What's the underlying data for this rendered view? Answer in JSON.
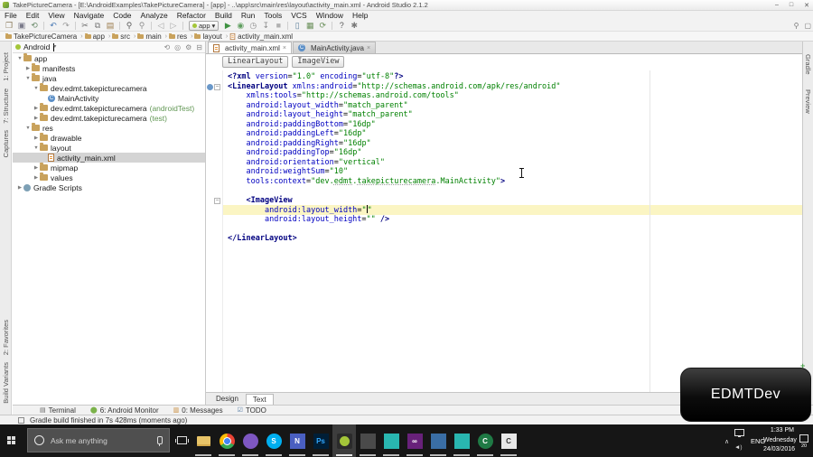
{
  "colors": {
    "accent_green": "#a4c639",
    "tag": "#000080",
    "attribute": "#0000c0",
    "value": "#008000",
    "selection": "#d4d4d4",
    "caret_line": "#fbf5c3",
    "suffix": "#629755",
    "taskbar_bg": "#161616"
  },
  "window": {
    "title": "TakePictureCamera - [E:\\AndroidExamples\\TakePictureCamera] - [app] - ..\\app\\src\\main\\res\\layout\\activity_main.xml - Android Studio 2.1.2",
    "minimize": "–",
    "maximize": "□",
    "close": "✕"
  },
  "menu": {
    "items": [
      "File",
      "Edit",
      "View",
      "Navigate",
      "Code",
      "Analyze",
      "Refactor",
      "Build",
      "Run",
      "Tools",
      "VCS",
      "Window",
      "Help"
    ]
  },
  "toolbar": {
    "run_config": "app",
    "run_caret": "▾",
    "icons": [
      {
        "name": "open-icon",
        "glyph": "❐",
        "color": "#8a7a5a"
      },
      {
        "name": "save-icon",
        "glyph": "▣",
        "color": "#7a7a8a"
      },
      {
        "name": "sync-files-icon",
        "glyph": "⟲",
        "color": "#6a8a6a"
      },
      {
        "name": "sep"
      },
      {
        "name": "undo-icon",
        "glyph": "↶",
        "color": "#4a7ab5"
      },
      {
        "name": "redo-icon",
        "glyph": "↷",
        "color": "#9a9a9a"
      },
      {
        "name": "sep"
      },
      {
        "name": "cut-icon",
        "glyph": "✂",
        "color": "#6a6a6a"
      },
      {
        "name": "copy-icon",
        "glyph": "⧉",
        "color": "#7a7a7a"
      },
      {
        "name": "paste-icon",
        "glyph": "▤",
        "color": "#9a7a4a"
      },
      {
        "name": "sep"
      },
      {
        "name": "find-icon",
        "glyph": "⚲",
        "color": "#5a5a5a"
      },
      {
        "name": "replace-icon",
        "glyph": "⚲",
        "color": "#8f8f8f"
      },
      {
        "name": "sep"
      },
      {
        "name": "back-icon",
        "glyph": "◁",
        "color": "#a5a5a5"
      },
      {
        "name": "forward-icon",
        "glyph": "▷",
        "color": "#a5a5a5"
      },
      {
        "name": "sep"
      },
      {
        "name": "run-config-select",
        "type": "chip"
      },
      {
        "name": "run-icon",
        "glyph": "▶",
        "color": "#3e9141"
      },
      {
        "name": "debug-icon",
        "glyph": "◉",
        "color": "#5f9e5f"
      },
      {
        "name": "coverage-icon",
        "glyph": "◷",
        "color": "#8a8a8a"
      },
      {
        "name": "attach-debugger-icon",
        "glyph": "↧",
        "color": "#8a8a8a"
      },
      {
        "name": "stop-icon",
        "glyph": "■",
        "color": "#b0b0b0"
      },
      {
        "name": "sep"
      },
      {
        "name": "avd-manager-icon",
        "glyph": "▯",
        "color": "#5a7f9a"
      },
      {
        "name": "sdk-manager-icon",
        "glyph": "▦",
        "color": "#6a8f5a"
      },
      {
        "name": "gradle-sync-icon",
        "glyph": "⟳",
        "color": "#6a8f5a"
      },
      {
        "name": "sep"
      },
      {
        "name": "help-icon",
        "glyph": "?",
        "color": "#5a5a5a"
      },
      {
        "name": "settings-icon",
        "glyph": "✱",
        "color": "#7a7a7a"
      }
    ],
    "right_icons": [
      {
        "name": "search-everywhere-icon",
        "glyph": "⚲"
      },
      {
        "name": "show-toolbar-icon",
        "glyph": "▢"
      }
    ]
  },
  "breadcrumbs": {
    "items": [
      "TakePictureCamera",
      "app",
      "src",
      "main",
      "res",
      "layout",
      "activity_main.xml"
    ],
    "separator": "›"
  },
  "left_stripe": {
    "top": [
      "1: Project",
      "7: Structure",
      "Captures"
    ],
    "bottom": [
      "2: Favorites",
      "Build Variants"
    ]
  },
  "right_stripe": {
    "items": [
      "Gradle",
      "Preview"
    ]
  },
  "project": {
    "selector": "Android",
    "selector_caret": "▾",
    "header_icons": [
      {
        "name": "collapse-all-icon",
        "glyph": "⟲"
      },
      {
        "name": "scroll-to-source-icon",
        "glyph": "◎"
      },
      {
        "name": "gear-icon",
        "glyph": "⚙"
      },
      {
        "name": "hide-panel-icon",
        "glyph": "⊟"
      }
    ],
    "tree": [
      {
        "label": "app",
        "depth": 0,
        "arrow": "down",
        "icon": "folder"
      },
      {
        "label": "manifests",
        "depth": 1,
        "arrow": "right",
        "icon": "folder"
      },
      {
        "label": "java",
        "depth": 1,
        "arrow": "down",
        "icon": "folder"
      },
      {
        "label": "dev.edmt.takepicturecamera",
        "depth": 2,
        "arrow": "down",
        "icon": "folder"
      },
      {
        "label": "MainActivity",
        "depth": 3,
        "arrow": "none",
        "icon": "class"
      },
      {
        "label": "dev.edmt.takepicturecamera",
        "suffix": "(androidTest)",
        "depth": 2,
        "arrow": "right",
        "icon": "folder"
      },
      {
        "label": "dev.edmt.takepicturecamera",
        "suffix": "(test)",
        "depth": 2,
        "arrow": "right",
        "icon": "folder"
      },
      {
        "label": "res",
        "depth": 1,
        "arrow": "down",
        "icon": "folder"
      },
      {
        "label": "drawable",
        "depth": 2,
        "arrow": "right",
        "icon": "folder"
      },
      {
        "label": "layout",
        "depth": 2,
        "arrow": "down",
        "icon": "folder"
      },
      {
        "label": "activity_main.xml",
        "depth": 3,
        "arrow": "none",
        "icon": "xml",
        "selected": true
      },
      {
        "label": "mipmap",
        "depth": 2,
        "arrow": "right",
        "icon": "folder"
      },
      {
        "label": "values",
        "depth": 2,
        "arrow": "right",
        "icon": "folder"
      },
      {
        "label": "Gradle Scripts",
        "depth": 0,
        "arrow": "right",
        "icon": "gradle"
      }
    ]
  },
  "editor": {
    "tabs": [
      {
        "label": "activity_main.xml",
        "icon": "xml",
        "close": "×",
        "active": true
      },
      {
        "label": "MainActivity.java",
        "icon": "class",
        "close": "×",
        "active": false
      }
    ],
    "chips": [
      "LinearLayout",
      "ImageView"
    ],
    "bottom_tabs": [
      {
        "label": "Design",
        "active": false
      },
      {
        "label": "Text",
        "active": true
      }
    ],
    "code": [
      {
        "seg": [
          [
            "<?xml ",
            "g"
          ],
          [
            "version",
            "a"
          ],
          [
            "=",
            "p"
          ],
          [
            "\"1.0\"",
            "v"
          ],
          [
            " ",
            "p"
          ],
          [
            "encoding",
            "a"
          ],
          [
            "=",
            "p"
          ],
          [
            "\"utf-8\"",
            "v"
          ],
          [
            "?>",
            "g"
          ]
        ]
      },
      {
        "seg": [
          [
            "<LinearLayout ",
            "g"
          ],
          [
            "xmlns:android",
            "a"
          ],
          [
            "=",
            "p"
          ],
          [
            "\"http://schemas.android.com/apk/res/android\"",
            "v"
          ]
        ],
        "fold": true,
        "gicon": true
      },
      {
        "seg": [
          [
            "    ",
            "p"
          ],
          [
            "xmlns:tools",
            "a"
          ],
          [
            "=",
            "p"
          ],
          [
            "\"http://schemas.android.com/tools\"",
            "v"
          ]
        ]
      },
      {
        "seg": [
          [
            "    ",
            "p"
          ],
          [
            "android:layout_width",
            "a"
          ],
          [
            "=",
            "p"
          ],
          [
            "\"match_parent\"",
            "v"
          ]
        ]
      },
      {
        "seg": [
          [
            "    ",
            "p"
          ],
          [
            "android:layout_height",
            "a"
          ],
          [
            "=",
            "p"
          ],
          [
            "\"match_parent\"",
            "v"
          ]
        ]
      },
      {
        "seg": [
          [
            "    ",
            "p"
          ],
          [
            "android:paddingBottom",
            "a"
          ],
          [
            "=",
            "p"
          ],
          [
            "\"16dp\"",
            "v"
          ]
        ]
      },
      {
        "seg": [
          [
            "    ",
            "p"
          ],
          [
            "android:paddingLeft",
            "a"
          ],
          [
            "=",
            "p"
          ],
          [
            "\"16dp\"",
            "v"
          ]
        ]
      },
      {
        "seg": [
          [
            "    ",
            "p"
          ],
          [
            "android:paddingRight",
            "a"
          ],
          [
            "=",
            "p"
          ],
          [
            "\"16dp\"",
            "v"
          ]
        ]
      },
      {
        "seg": [
          [
            "    ",
            "p"
          ],
          [
            "android:paddingTop",
            "a"
          ],
          [
            "=",
            "p"
          ],
          [
            "\"16dp\"",
            "v"
          ]
        ]
      },
      {
        "seg": [
          [
            "    ",
            "p"
          ],
          [
            "android:orientation",
            "a"
          ],
          [
            "=",
            "p"
          ],
          [
            "\"vertical\"",
            "v"
          ]
        ]
      },
      {
        "seg": [
          [
            "    ",
            "p"
          ],
          [
            "android:weightSum",
            "a"
          ],
          [
            "=",
            "p"
          ],
          [
            "\"10\"",
            "v"
          ]
        ]
      },
      {
        "seg": [
          [
            "    ",
            "p"
          ],
          [
            "tools:context",
            "a"
          ],
          [
            "=",
            "p"
          ],
          [
            "\"dev.",
            "v"
          ],
          [
            "edmt",
            "u"
          ],
          [
            ".",
            "v"
          ],
          [
            "takepicturecamera",
            "u"
          ],
          [
            ".MainActivity\"",
            "v"
          ],
          [
            ">",
            "g"
          ]
        ]
      },
      {
        "seg": []
      },
      {
        "seg": [
          [
            "    ",
            "p"
          ],
          [
            "<ImageView",
            "g"
          ]
        ],
        "fold": true
      },
      {
        "seg": [
          [
            "        ",
            "p"
          ],
          [
            "android:layout_width",
            "a"
          ],
          [
            "=",
            "p"
          ],
          [
            "\"",
            "v"
          ],
          [
            "",
            "c"
          ],
          [
            "\"",
            "v"
          ]
        ],
        "hl": true
      },
      {
        "seg": [
          [
            "        ",
            "p"
          ],
          [
            "android:layout_height",
            "a"
          ],
          [
            "=",
            "p"
          ],
          [
            "\"\"",
            "v"
          ],
          [
            " ",
            "p"
          ],
          [
            "/>",
            "g"
          ]
        ]
      },
      {
        "seg": []
      },
      {
        "seg": [
          [
            "</LinearLayout>",
            "g"
          ]
        ]
      }
    ]
  },
  "bottom_bar": {
    "items": [
      {
        "label": "Terminal",
        "icon": "terminal",
        "glyph": "▤",
        "color": "#666"
      },
      {
        "label": "6: Android Monitor",
        "icon": "android-monitor",
        "glyph": "⬤",
        "color": "#7bb24a"
      },
      {
        "label": "0: Messages",
        "icon": "messages",
        "glyph": "▥",
        "color": "#c98b3a"
      },
      {
        "label": "TODO",
        "icon": "todo",
        "glyph": "☑",
        "color": "#5a7fa8"
      }
    ]
  },
  "status_bar": {
    "message": "Gradle build finished in 7s 428ms (moments ago)"
  },
  "taskbar": {
    "search_placeholder": "Ask me anything",
    "apps": [
      {
        "name": "file-explorer",
        "style": "folder",
        "label": ""
      },
      {
        "name": "chrome",
        "style": "chrome",
        "label": ""
      },
      {
        "name": "media-player",
        "bg": "#7e57c2",
        "label": "",
        "round": true
      },
      {
        "name": "skype",
        "bg": "#00aff0",
        "label": "S",
        "round": true
      },
      {
        "name": "onenote",
        "bg": "#4a5fc1",
        "label": "N"
      },
      {
        "name": "photoshop",
        "bg": "#001e36",
        "label": "Ps",
        "fg": "#31a8ff"
      },
      {
        "name": "android-studio",
        "style": "as",
        "label": "",
        "active": true
      },
      {
        "name": "emulator",
        "bg": "#4a4a4a",
        "label": ""
      },
      {
        "name": "notes-app",
        "bg": "#29b6b0",
        "label": ""
      },
      {
        "name": "visual-studio",
        "bg": "#68217a",
        "label": "∞"
      },
      {
        "name": "my-computer",
        "bg": "#3a6ea5",
        "label": ""
      },
      {
        "name": "notes-app-2",
        "bg": "#29b6b0",
        "label": ""
      },
      {
        "name": "camtasia",
        "bg": "#1f7a45",
        "label": "C",
        "round": true
      },
      {
        "name": "camtasia-recorder",
        "bg": "#e8e8e8",
        "label": "C",
        "fg": "#333"
      }
    ],
    "tray": {
      "lang": "ENG",
      "time": "1:33 PM",
      "day": "Wednesday",
      "date": "24/03/2016",
      "badge": "20",
      "chevron": "∧",
      "speaker": "◄)"
    }
  },
  "watermark": {
    "label": "EDMTDev"
  },
  "green_plus": "+"
}
